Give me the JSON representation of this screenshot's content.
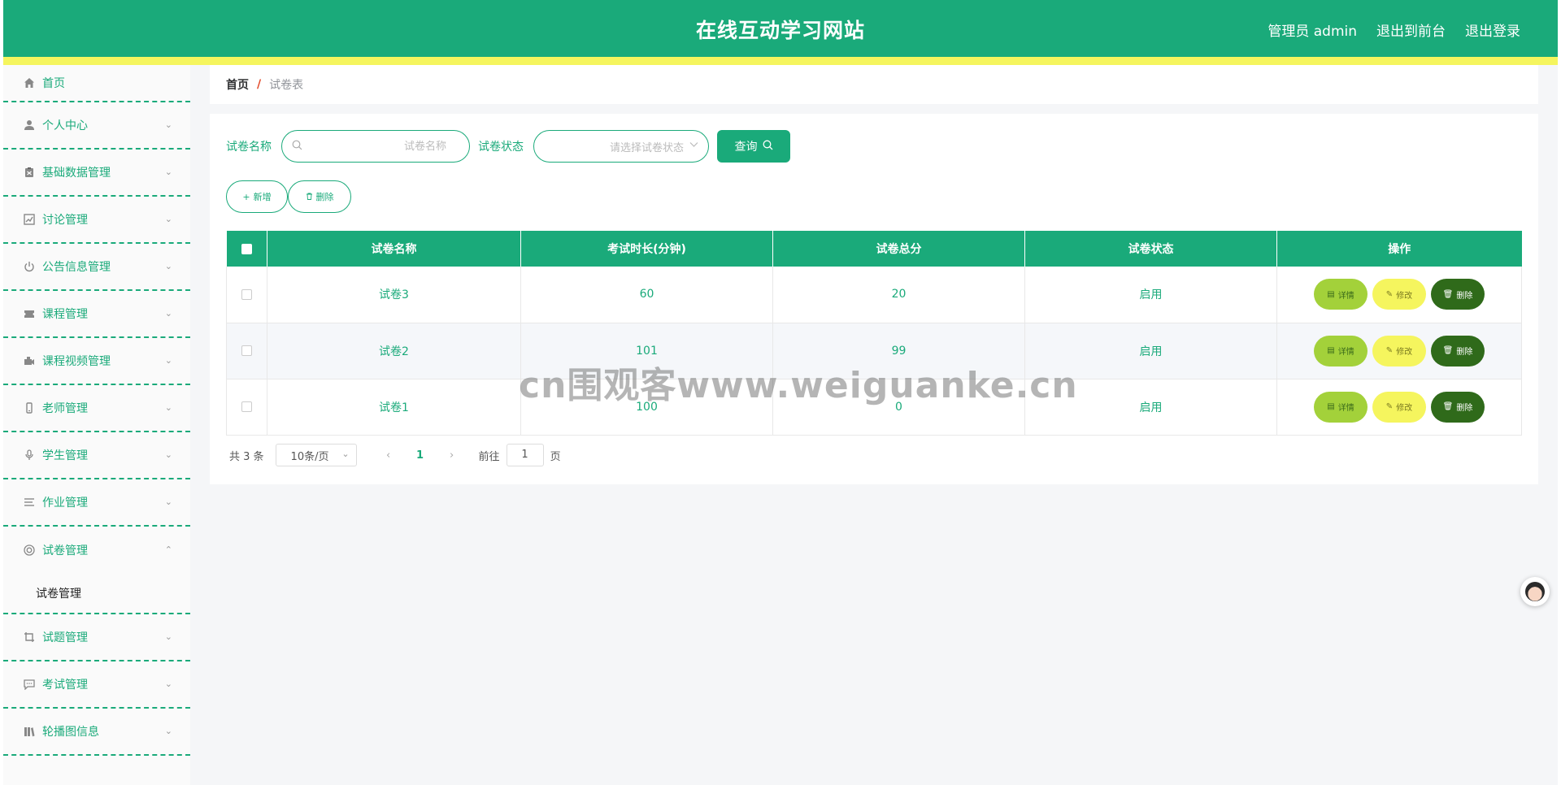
{
  "header": {
    "title": "在线互动学习网站",
    "admin_label": "管理员 admin",
    "front_label": "退出到前台",
    "logout_label": "退出登录"
  },
  "sidebar": {
    "items": [
      {
        "label": "首页",
        "icon": "home-icon"
      },
      {
        "label": "个人中心",
        "icon": "user-icon"
      },
      {
        "label": "基础数据管理",
        "icon": "clipboard-icon"
      },
      {
        "label": "讨论管理",
        "icon": "chart-icon"
      },
      {
        "label": "公告信息管理",
        "icon": "power-icon"
      },
      {
        "label": "课程管理",
        "icon": "ticket-icon"
      },
      {
        "label": "课程视频管理",
        "icon": "video-icon"
      },
      {
        "label": "老师管理",
        "icon": "phone-icon"
      },
      {
        "label": "学生管理",
        "icon": "mic-icon"
      },
      {
        "label": "作业管理",
        "icon": "list-icon"
      },
      {
        "label": "试卷管理",
        "icon": "lifebuoy-icon"
      },
      {
        "label": "试题管理",
        "icon": "crop-icon"
      },
      {
        "label": "考试管理",
        "icon": "message-icon"
      },
      {
        "label": "轮播图信息",
        "icon": "books-icon"
      }
    ],
    "submenu_label": "试卷管理"
  },
  "breadcrumb": {
    "home": "首页",
    "separator": "/",
    "current": "试卷表"
  },
  "search": {
    "name_label": "试卷名称",
    "name_placeholder": "试卷名称",
    "status_label": "试卷状态",
    "status_placeholder": "请选择试卷状态",
    "query_label": "查询"
  },
  "actions": {
    "add_label": "新增",
    "delete_label": "删除"
  },
  "table": {
    "headers": [
      "试卷名称",
      "考试时长(分钟)",
      "试卷总分",
      "试卷状态",
      "操作"
    ],
    "rows": [
      {
        "name": "试卷3",
        "duration": "60",
        "score": "20",
        "status": "启用"
      },
      {
        "name": "试卷2",
        "duration": "101",
        "score": "99",
        "status": "启用"
      },
      {
        "name": "试卷1",
        "duration": "100",
        "score": "0",
        "status": "启用"
      }
    ],
    "op_detail": "详情",
    "op_edit": "修改",
    "op_delete": "删除"
  },
  "pagination": {
    "total": "共 3 条",
    "page_size": "10条/页",
    "current_page": "1",
    "goto_prefix": "前往",
    "goto_value": "1",
    "goto_suffix": "页"
  },
  "watermark": "cn围观客www.weiguanke.cn",
  "colors": {
    "primary": "#1aaa7a",
    "stripe": "#f5f55e",
    "detail": "#a3d13a",
    "edit": "#f5f55e",
    "delete": "#2f6a1a"
  }
}
